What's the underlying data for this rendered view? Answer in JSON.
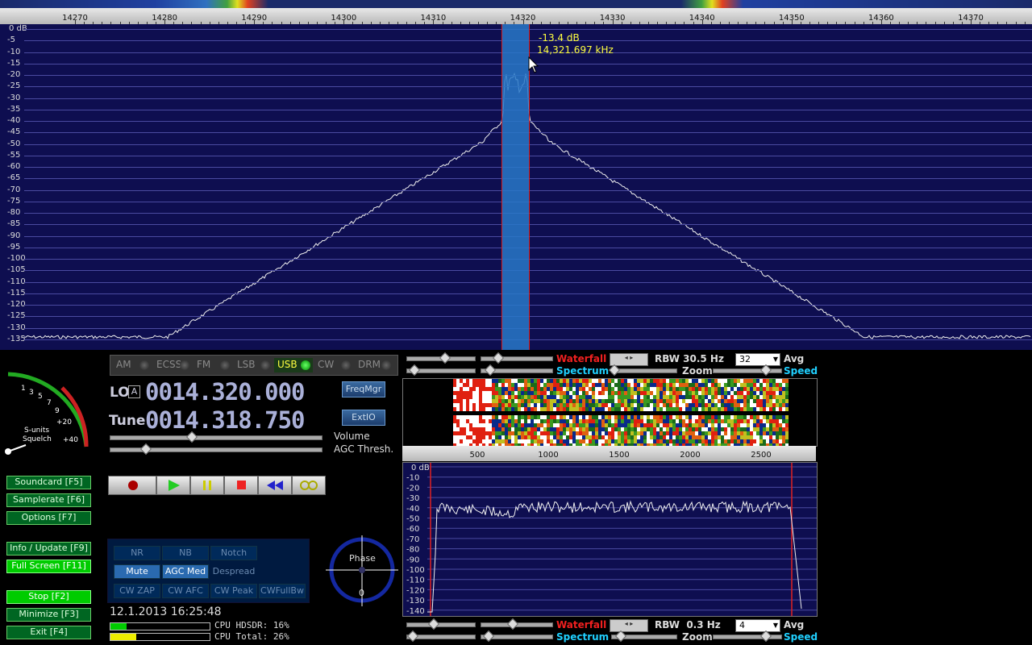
{
  "ruler": {
    "ticks": [
      "14270",
      "14280",
      "14290",
      "14300",
      "14310",
      "14320",
      "14330",
      "14340",
      "14350",
      "14360",
      "14370"
    ]
  },
  "main_spectrum": {
    "db_labels": [
      "0 dB",
      "-5",
      "-10",
      "-15",
      "-20",
      "-25",
      "-30",
      "-35",
      "-40",
      "-45",
      "-50",
      "-55",
      "-60",
      "-65",
      "-70",
      "-75",
      "-80",
      "-85",
      "-90",
      "-95",
      "-100",
      "-105",
      "-110",
      "-115",
      "-120",
      "-125",
      "-130",
      "-135"
    ],
    "cursor_db": "-13.4 dB",
    "cursor_freq": "14,321.697 kHz"
  },
  "modes": [
    {
      "label": "AM",
      "active": false
    },
    {
      "label": "ECSS",
      "active": false
    },
    {
      "label": "FM",
      "active": false
    },
    {
      "label": "LSB",
      "active": false
    },
    {
      "label": "USB",
      "active": true
    },
    {
      "label": "CW",
      "active": false
    },
    {
      "label": "DRM",
      "active": false
    }
  ],
  "lo": {
    "label": "LO",
    "badge": "A",
    "value": "0014.320.000"
  },
  "tune": {
    "label": "Tune",
    "value": "0014.318.750"
  },
  "buttons": {
    "freqmgr": "FreqMgr",
    "extio": "ExtIO",
    "soundcard": "Soundcard [F5]",
    "samplerate": "Samplerate [F6]",
    "options": "Options [F7]",
    "info": "Info / Update [F9]",
    "fullscreen": "Full Screen [F11]",
    "stop": "Stop [F2]",
    "minimize": "Minimize [F3]",
    "exit": "Exit [F4]"
  },
  "sliders": {
    "volume": "Volume",
    "agc": "AGC Thresh."
  },
  "smeter": {
    "labels": [
      "1",
      "3",
      "5",
      "7",
      "9",
      "+20",
      "+40"
    ],
    "caption1": "S-units",
    "caption2": "Squelch"
  },
  "dsp": {
    "nr": "NR",
    "nb": "NB",
    "notch": "Notch",
    "mute": "Mute",
    "agc": "AGC Med",
    "despread": "Despread",
    "cwzap": "CW ZAP",
    "cwafc": "CW AFC",
    "cwpeak": "CW Peak",
    "cwfullbw": "CWFullBw"
  },
  "phase": {
    "label": "Phase",
    "value": "0"
  },
  "status": {
    "datetime": "12.1.2013 16:25:48",
    "cpu_hdsdr": "CPU HDSDR: 16%",
    "cpu_total": "CPU Total: 26%",
    "cpu_hdsdr_fraction": 0.16,
    "cpu_total_fraction": 0.26
  },
  "af_top": {
    "waterfall": "Waterfall",
    "rbw": "RBW 30.5 Hz",
    "avg_value": "32",
    "avg": "Avg",
    "spectrum": "Spectrum",
    "zoom": "Zoom",
    "speed": "Speed"
  },
  "af_bottom": {
    "waterfall": "Waterfall",
    "rbw": "RBW  0.3 Hz",
    "avg_value": "4",
    "avg": "Avg",
    "spectrum": "Spectrum",
    "zoom": "Zoom",
    "speed": "Speed"
  },
  "af_axis": {
    "ticks": [
      "500",
      "1000",
      "1500",
      "2000",
      "2500"
    ]
  },
  "af_spectrum": {
    "db_labels": [
      "0 dB",
      "-10",
      "-20",
      "-30",
      "-40",
      "-50",
      "-60",
      "-70",
      "-80",
      "-90",
      "-100",
      "-110",
      "-120",
      "-130",
      "-140"
    ]
  }
}
